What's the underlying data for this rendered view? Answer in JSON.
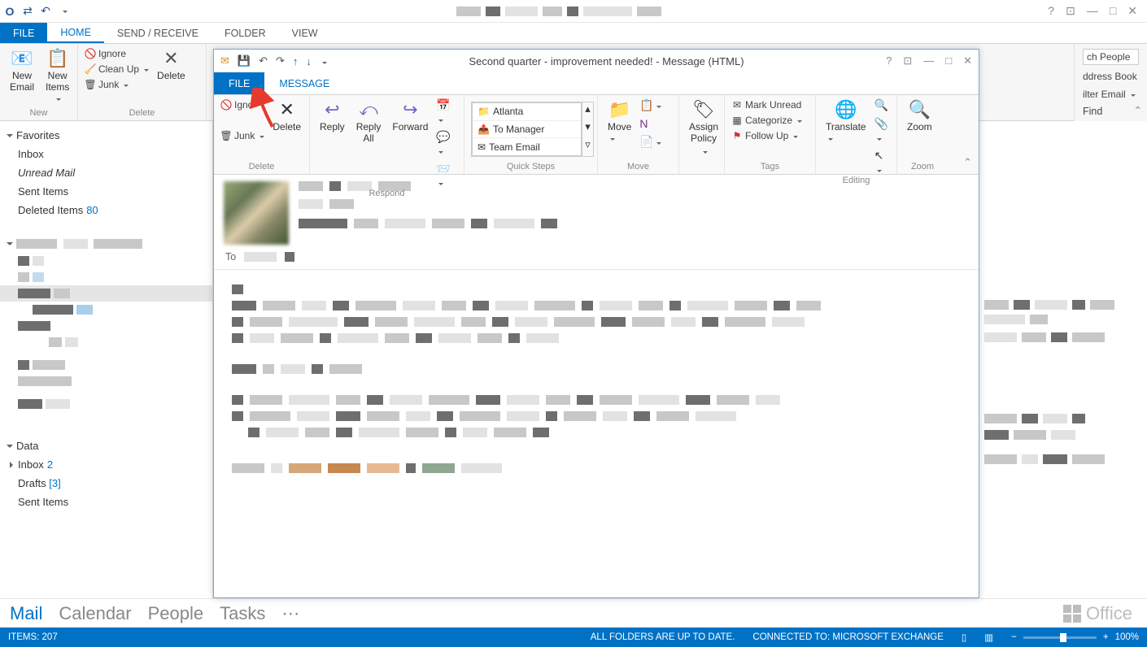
{
  "mainWindow": {
    "tabs": {
      "file": "FILE",
      "home": "HOME",
      "sendReceive": "SEND / RECEIVE",
      "folder": "FOLDER",
      "view": "VIEW"
    },
    "ribbon": {
      "new": {
        "newEmail": "New\nEmail",
        "newItems": "New\nItems",
        "label": "New"
      },
      "delete": {
        "ignore": "Ignore",
        "cleanUp": "Clean Up",
        "junk": "Junk",
        "delete": "Delete",
        "label": "Delete"
      },
      "find": {
        "searchPeople": "ch People",
        "addressBook": "ddress Book",
        "filterEmail": "ilter Email",
        "find": "Find"
      }
    }
  },
  "sidebar": {
    "favorites": "Favorites",
    "favItems": [
      {
        "label": "Inbox"
      },
      {
        "label": "Unread Mail",
        "italic": true
      },
      {
        "label": "Sent Items"
      },
      {
        "label": "Deleted Items",
        "count": "80"
      }
    ],
    "data": "Data",
    "dataItems": [
      {
        "label": "Inbox",
        "count": "2"
      },
      {
        "label": "Drafts",
        "bracket": "[3]"
      },
      {
        "label": "Sent Items"
      }
    ]
  },
  "msgWindow": {
    "title": "Second quarter - improvement needed! - Message (HTML)",
    "tabs": {
      "file": "FILE",
      "message": "MESSAGE"
    },
    "ribbon": {
      "delete": {
        "ignore": "Igno",
        "junk": "Junk",
        "delete": "Delete",
        "label": "Delete"
      },
      "respond": {
        "reply": "Reply",
        "replyAll": "Reply\nAll",
        "forward": "Forward",
        "label": "Respond"
      },
      "quickSteps": {
        "atlanta": "Atlanta",
        "toManager": "To Manager",
        "teamEmail": "Team Email",
        "label": "Quick Steps"
      },
      "move": {
        "move": "Move",
        "assignPolicy": "Assign\nPolicy",
        "label": "Move"
      },
      "tags": {
        "markUnread": "Mark Unread",
        "categorize": "Categorize",
        "followUp": "Follow Up",
        "label": "Tags"
      },
      "editing": {
        "translate": "Translate",
        "label": "Editing"
      },
      "zoom": {
        "zoom": "Zoom",
        "label": "Zoom"
      }
    },
    "to": "To"
  },
  "nav": {
    "mail": "Mail",
    "calendar": "Calendar",
    "people": "People",
    "tasks": "Tasks"
  },
  "status": {
    "items": "ITEMS: 207",
    "folders": "ALL FOLDERS ARE UP TO DATE.",
    "connected": "CONNECTED TO: MICROSOFT EXCHANGE",
    "zoom": "100%"
  },
  "office": "Office"
}
